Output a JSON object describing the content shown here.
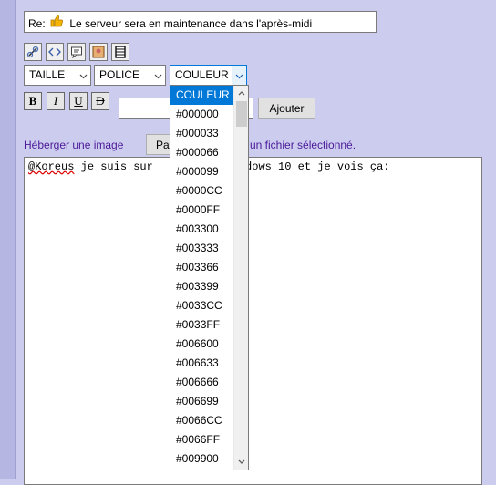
{
  "subject": {
    "prefix": "Re:",
    "title": "Le serveur sera en maintenance dans l'après-midi"
  },
  "selects": {
    "taille": "TAILLE",
    "police": "POLICE",
    "couleur": "COULEUR"
  },
  "format_buttons": {
    "bold": "B",
    "italic": "I",
    "underline": "U",
    "strike": "D"
  },
  "ajouter_label": "Ajouter",
  "upload": {
    "host_label": "Héberger une image",
    "browse_label": "Pa",
    "no_file": "un fichier sélectionné."
  },
  "message_parts": {
    "mention": "@Koreus",
    "before_gap": " je suis sur",
    "after_gap": "ndows 10 et je vois ça:"
  },
  "color_options": [
    "COULEUR",
    "#000000",
    "#000033",
    "#000066",
    "#000099",
    "#0000CC",
    "#0000FF",
    "#003300",
    "#003333",
    "#003366",
    "#003399",
    "#0033CC",
    "#0033FF",
    "#006600",
    "#006633",
    "#006666",
    "#006699",
    "#0066CC",
    "#0066FF",
    "#009900"
  ],
  "colors": {
    "background": "#ccccee",
    "selected": "#0078d7",
    "link": "#4b1a99"
  }
}
